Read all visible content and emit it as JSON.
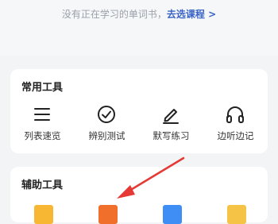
{
  "notice": {
    "text": "没有正在学习的单词书，",
    "link": "去选课程 >"
  },
  "common_tools": {
    "title": "常用工具",
    "items": [
      {
        "label": "列表速览",
        "icon": "list-icon"
      },
      {
        "label": "辨别测试",
        "icon": "check-circle-icon"
      },
      {
        "label": "默写练习",
        "icon": "pencil-icon"
      },
      {
        "label": "边听边记",
        "icon": "headphones-icon"
      }
    ]
  },
  "aux_tools": {
    "title": "辅助工具",
    "icons": [
      "yellow-tool-icon",
      "orange-tool-icon",
      "blue-tool-icon",
      "gold-tool-icon"
    ]
  },
  "colors": {
    "link": "#3a63c8",
    "arrow": "#e53935"
  }
}
